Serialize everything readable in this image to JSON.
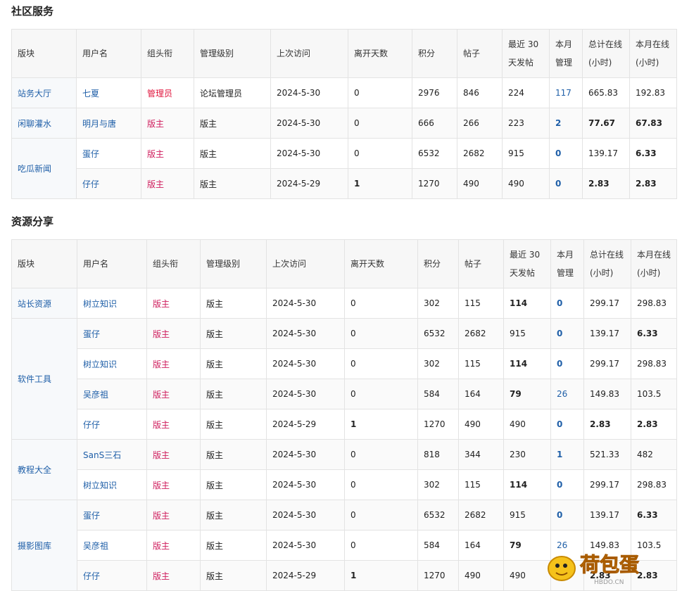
{
  "headers": [
    "版块",
    "用户名",
    "组头衔",
    "管理级别",
    "上次访问",
    "离开天数",
    "积分",
    "帖子",
    "最近 30 天发帖",
    "本月管理",
    "总计在线(小时)",
    "本月在线(小时)"
  ],
  "sections": [
    {
      "title": "社区服务",
      "groups": [
        {
          "forum": "站务大厅",
          "rows": [
            {
              "user": "七夏",
              "title": "管理员",
              "level": "论坛管理员",
              "last": "2024-5-30",
              "days": "0",
              "points": "2976",
              "posts": "846",
              "recent": "224",
              "month_admin": "117",
              "total_online": "665.83",
              "month_online": "192.83",
              "style": {
                "days_b": false,
                "recent_b": false,
                "admin_b": false,
                "total_b": false,
                "month_b": false
              }
            }
          ]
        },
        {
          "forum": "闲聊灌水",
          "rows": [
            {
              "user": "明月与唐",
              "title": "版主",
              "level": "版主",
              "last": "2024-5-30",
              "days": "0",
              "points": "666",
              "posts": "266",
              "recent": "223",
              "month_admin": "2",
              "total_online": "77.67",
              "month_online": "67.83",
              "style": {
                "days_b": false,
                "recent_b": false,
                "admin_b": true,
                "total_b": true,
                "month_b": true
              }
            }
          ]
        },
        {
          "forum": "吃瓜新闻",
          "rows": [
            {
              "user": "蛋仔",
              "title": "版主",
              "level": "版主",
              "last": "2024-5-30",
              "days": "0",
              "points": "6532",
              "posts": "2682",
              "recent": "915",
              "month_admin": "0",
              "total_online": "139.17",
              "month_online": "6.33",
              "style": {
                "days_b": false,
                "recent_b": false,
                "admin_b": true,
                "total_b": false,
                "month_b": true
              }
            },
            {
              "user": "仔仔",
              "title": "版主",
              "level": "版主",
              "last": "2024-5-29",
              "days": "1",
              "points": "1270",
              "posts": "490",
              "recent": "490",
              "month_admin": "0",
              "total_online": "2.83",
              "month_online": "2.83",
              "style": {
                "days_b": true,
                "recent_b": false,
                "admin_b": true,
                "total_b": true,
                "month_b": true
              }
            }
          ]
        }
      ]
    },
    {
      "title": "资源分享",
      "groups": [
        {
          "forum": "站长资源",
          "rows": [
            {
              "user": "树立知识",
              "title": "版主",
              "level": "版主",
              "last": "2024-5-30",
              "days": "0",
              "points": "302",
              "posts": "115",
              "recent": "114",
              "month_admin": "0",
              "total_online": "299.17",
              "month_online": "298.83",
              "style": {
                "days_b": false,
                "recent_b": true,
                "admin_b": true,
                "total_b": false,
                "month_b": false
              }
            }
          ]
        },
        {
          "forum": "软件工具",
          "rows": [
            {
              "user": "蛋仔",
              "title": "版主",
              "level": "版主",
              "last": "2024-5-30",
              "days": "0",
              "points": "6532",
              "posts": "2682",
              "recent": "915",
              "month_admin": "0",
              "total_online": "139.17",
              "month_online": "6.33",
              "style": {
                "days_b": false,
                "recent_b": false,
                "admin_b": true,
                "total_b": false,
                "month_b": true
              }
            },
            {
              "user": "树立知识",
              "title": "版主",
              "level": "版主",
              "last": "2024-5-30",
              "days": "0",
              "points": "302",
              "posts": "115",
              "recent": "114",
              "month_admin": "0",
              "total_online": "299.17",
              "month_online": "298.83",
              "style": {
                "days_b": false,
                "recent_b": true,
                "admin_b": true,
                "total_b": false,
                "month_b": false
              }
            },
            {
              "user": "吴彦祖",
              "title": "版主",
              "level": "版主",
              "last": "2024-5-30",
              "days": "0",
              "points": "584",
              "posts": "164",
              "recent": "79",
              "month_admin": "26",
              "total_online": "149.83",
              "month_online": "103.5",
              "style": {
                "days_b": false,
                "recent_b": true,
                "admin_b": false,
                "total_b": false,
                "month_b": false
              }
            },
            {
              "user": "仔仔",
              "title": "版主",
              "level": "版主",
              "last": "2024-5-29",
              "days": "1",
              "points": "1270",
              "posts": "490",
              "recent": "490",
              "month_admin": "0",
              "total_online": "2.83",
              "month_online": "2.83",
              "style": {
                "days_b": true,
                "recent_b": false,
                "admin_b": true,
                "total_b": true,
                "month_b": true
              }
            }
          ]
        },
        {
          "forum": "教程大全",
          "rows": [
            {
              "user": "SanS三石",
              "title": "版主",
              "level": "版主",
              "last": "2024-5-30",
              "days": "0",
              "points": "818",
              "posts": "344",
              "recent": "230",
              "month_admin": "1",
              "total_online": "521.33",
              "month_online": "482",
              "style": {
                "days_b": false,
                "recent_b": false,
                "admin_b": true,
                "total_b": false,
                "month_b": false
              }
            },
            {
              "user": "树立知识",
              "title": "版主",
              "level": "版主",
              "last": "2024-5-30",
              "days": "0",
              "points": "302",
              "posts": "115",
              "recent": "114",
              "month_admin": "0",
              "total_online": "299.17",
              "month_online": "298.83",
              "style": {
                "days_b": false,
                "recent_b": true,
                "admin_b": true,
                "total_b": false,
                "month_b": false
              }
            }
          ]
        },
        {
          "forum": "摄影图库",
          "rows": [
            {
              "user": "蛋仔",
              "title": "版主",
              "level": "版主",
              "last": "2024-5-30",
              "days": "0",
              "points": "6532",
              "posts": "2682",
              "recent": "915",
              "month_admin": "0",
              "total_online": "139.17",
              "month_online": "6.33",
              "style": {
                "days_b": false,
                "recent_b": false,
                "admin_b": true,
                "total_b": false,
                "month_b": true
              }
            },
            {
              "user": "吴彦祖",
              "title": "版主",
              "level": "版主",
              "last": "2024-5-30",
              "days": "0",
              "points": "584",
              "posts": "164",
              "recent": "79",
              "month_admin": "26",
              "total_online": "149.83",
              "month_online": "103.5",
              "style": {
                "days_b": false,
                "recent_b": true,
                "admin_b": false,
                "total_b": false,
                "month_b": false
              }
            },
            {
              "user": "仔仔",
              "title": "版主",
              "level": "版主",
              "last": "2024-5-29",
              "days": "1",
              "points": "1270",
              "posts": "490",
              "recent": "490",
              "month_admin": "0",
              "total_online": "2.83",
              "month_online": "2.83",
              "style": {
                "days_b": true,
                "recent_b": false,
                "admin_b": true,
                "total_b": true,
                "month_b": true
              }
            }
          ]
        }
      ]
    }
  ],
  "watermark": {
    "brand": "荷包蛋",
    "site": "HBDO.CN"
  },
  "colors": {
    "link": "#1f5fa8",
    "admin_role": "#e0153d",
    "mod_role": "#cf1d5d",
    "header_bg": "#f7f7f7",
    "border": "#e3e3e3"
  }
}
